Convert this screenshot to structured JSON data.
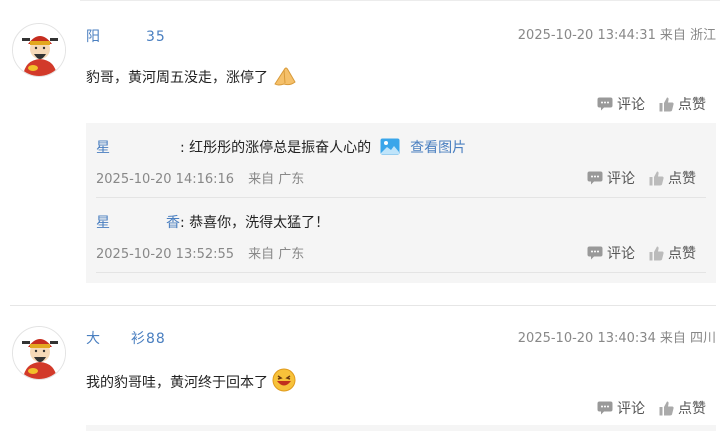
{
  "comments": [
    {
      "username": "阳   35",
      "time": "2025-10-20 13:44:31",
      "location": "来自 浙江",
      "content": "豹哥，黄河周五没走，涨停了",
      "emoji": "pray-hands-emoji",
      "comment_label": "评论",
      "like_label": "点赞",
      "replies": [
        {
          "username": "星     ",
          "text": "红彤彤的涨停总是振奋人心的",
          "view_image": "查看图片",
          "time": "2025-10-20 14:16:16",
          "location": "来自 广东",
          "comment_label": "评论",
          "like_label": "点赞"
        },
        {
          "username": "星    香",
          "text": "恭喜你，洗得太猛了！",
          "time": "2025-10-20 13:52:55",
          "location": "来自 广东",
          "comment_label": "评论",
          "like_label": "点赞"
        }
      ]
    },
    {
      "username": "大  衫88",
      "time": "2025-10-20 13:40:34",
      "location": "来自 四川",
      "content": "我的豹哥哇，黄河终于回本了",
      "emoji": "laughing-face-emoji",
      "comment_label": "评论",
      "like_label": "点赞"
    }
  ],
  "colors": {
    "link": "#4a7fc0",
    "meta": "#888888",
    "reply_bg": "#f5f5f5"
  }
}
